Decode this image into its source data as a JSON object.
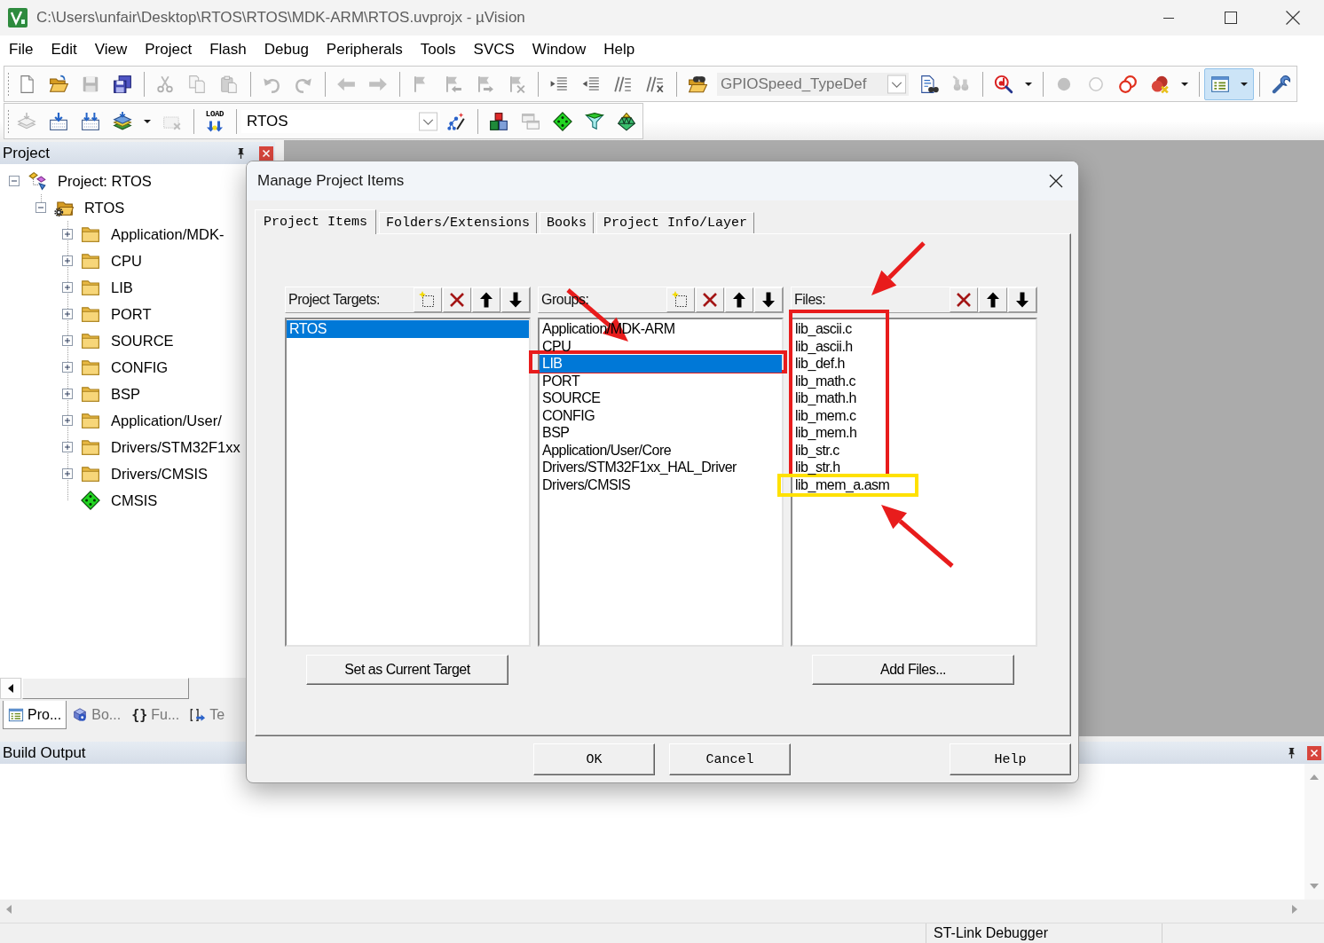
{
  "window": {
    "title": "C:\\Users\\unfair\\Desktop\\RTOS\\RTOS\\MDK-ARM\\RTOS.uvprojx - µVision"
  },
  "menu": [
    "File",
    "Edit",
    "View",
    "Project",
    "Flash",
    "Debug",
    "Peripherals",
    "Tools",
    "SVCS",
    "Window",
    "Help"
  ],
  "toolbar_1": [
    [
      {
        "kind": "button",
        "disabled": false,
        "pressed": false
      },
      {
        "kind": "button",
        "disabled": false,
        "pressed": false
      },
      {
        "kind": "button",
        "disabled": true,
        "pressed": false
      },
      {
        "kind": "button",
        "disabled": false,
        "pressed": false
      }
    ],
    [
      {
        "kind": "button",
        "disabled": true,
        "pressed": false
      },
      {
        "kind": "button",
        "disabled": true,
        "pressed": false
      },
      {
        "kind": "button",
        "disabled": true,
        "pressed": false
      }
    ],
    [
      {
        "kind": "button",
        "disabled": true,
        "pressed": false
      },
      {
        "kind": "button",
        "disabled": true,
        "pressed": false
      }
    ],
    [
      {
        "kind": "button",
        "disabled": true,
        "pressed": false
      },
      {
        "kind": "button",
        "disabled": true,
        "pressed": false
      }
    ],
    [
      {
        "kind": "button",
        "disabled": true,
        "pressed": false
      },
      {
        "kind": "button",
        "disabled": true,
        "pressed": false
      },
      {
        "kind": "button",
        "disabled": true,
        "pressed": false
      },
      {
        "kind": "button",
        "disabled": true,
        "pressed": false
      }
    ],
    [
      {
        "kind": "button",
        "disabled": false,
        "pressed": false
      },
      {
        "kind": "button",
        "disabled": false,
        "pressed": false
      },
      {
        "kind": "button",
        "disabled": false,
        "pressed": false
      },
      {
        "kind": "button",
        "disabled": false,
        "pressed": false
      }
    ],
    [
      {
        "kind": "button",
        "disabled": false,
        "pressed": false
      },
      {
        "kind": "combo",
        "value": "GPIOSpeed_TypeDef"
      },
      {
        "kind": "button",
        "disabled": false,
        "pressed": false
      },
      {
        "kind": "button",
        "disabled": true,
        "pressed": false
      }
    ],
    [
      {
        "kind": "split",
        "disabled": false,
        "pressed": false
      }
    ],
    [
      {
        "kind": "button",
        "disabled": true,
        "pressed": false
      },
      {
        "kind": "button",
        "disabled": true,
        "pressed": false
      },
      {
        "kind": "button",
        "disabled": false,
        "pressed": false
      },
      {
        "kind": "split",
        "disabled": false,
        "pressed": false
      }
    ],
    [
      {
        "kind": "split",
        "disabled": false,
        "pressed": true
      }
    ],
    [
      {
        "kind": "button",
        "disabled": false,
        "pressed": false
      }
    ]
  ],
  "toolbar_2": [
    [
      {
        "kind": "button",
        "disabled": true,
        "pressed": false
      },
      {
        "kind": "button",
        "disabled": false,
        "pressed": false
      },
      {
        "kind": "button",
        "disabled": false,
        "pressed": false
      },
      {
        "kind": "split",
        "disabled": false,
        "pressed": false
      },
      {
        "kind": "button",
        "disabled": true,
        "pressed": false
      }
    ],
    [
      {
        "kind": "button",
        "label": "LOAD",
        "disabled": false,
        "pressed": false
      }
    ],
    [
      {
        "kind": "combo",
        "value": "RTOS"
      },
      {
        "kind": "button",
        "disabled": false,
        "pressed": false
      }
    ],
    [
      {
        "kind": "button",
        "disabled": false,
        "pressed": false
      },
      {
        "kind": "button",
        "disabled": true,
        "pressed": false
      },
      {
        "kind": "button",
        "disabled": false,
        "pressed": false
      },
      {
        "kind": "button",
        "disabled": false,
        "pressed": false
      },
      {
        "kind": "button",
        "disabled": false,
        "pressed": false
      }
    ]
  ],
  "project_panel": {
    "title": "Project",
    "tree": [
      {
        "label": "Project: RTOS",
        "kind": "project",
        "expanded": true,
        "children": [
          {
            "label": "RTOS",
            "kind": "target",
            "expanded": true,
            "children": [
              {
                "label": "Application/MDK-",
                "kind": "group",
                "expanded": false
              },
              {
                "label": "CPU",
                "kind": "group",
                "expanded": false
              },
              {
                "label": "LIB",
                "kind": "group",
                "expanded": false
              },
              {
                "label": "PORT",
                "kind": "group",
                "expanded": false
              },
              {
                "label": "SOURCE",
                "kind": "group",
                "expanded": false
              },
              {
                "label": "CONFIG",
                "kind": "group",
                "expanded": false
              },
              {
                "label": "BSP",
                "kind": "group",
                "expanded": false
              },
              {
                "label": "Application/User/",
                "kind": "group",
                "expanded": false
              },
              {
                "label": "Drivers/STM32F1xx",
                "kind": "group",
                "expanded": false
              },
              {
                "label": "Drivers/CMSIS",
                "kind": "group",
                "expanded": false
              },
              {
                "label": "CMSIS",
                "kind": "component"
              }
            ]
          }
        ]
      }
    ],
    "tabs": [
      {
        "label": "Pro...",
        "selected": true
      },
      {
        "label": "Bo...",
        "selected": false
      },
      {
        "glyph": "{}",
        "label": "Fu...",
        "selected": false
      },
      {
        "label": "Te",
        "selected": false
      }
    ]
  },
  "build_output": {
    "title": "Build Output"
  },
  "status_bar": {
    "text": "ST-Link Debugger"
  },
  "dialog": {
    "title": "Manage Project Items",
    "tabs": [
      {
        "label": "Project Items",
        "selected": true
      },
      {
        "label": "Folders/Extensions",
        "selected": false
      },
      {
        "label": "Books",
        "selected": false
      },
      {
        "label": "Project Info/Layer",
        "selected": false
      }
    ],
    "panels": [
      {
        "kind": "targets",
        "label": "Project Targets:",
        "items": [
          {
            "label": "RTOS",
            "selected": true
          }
        ],
        "button": "Set as Current Target"
      },
      {
        "kind": "groups",
        "label": "Groups:",
        "items": [
          {
            "label": "Application/MDK-ARM",
            "selected": false
          },
          {
            "label": "CPU",
            "selected": false
          },
          {
            "label": "LIB",
            "selected": true
          },
          {
            "label": "PORT",
            "selected": false
          },
          {
            "label": "SOURCE",
            "selected": false
          },
          {
            "label": "CONFIG",
            "selected": false
          },
          {
            "label": "BSP",
            "selected": false
          },
          {
            "label": "Application/User/Core",
            "selected": false
          },
          {
            "label": "Drivers/STM32F1xx_HAL_Driver",
            "selected": false
          },
          {
            "label": "Drivers/CMSIS",
            "selected": false
          }
        ]
      },
      {
        "kind": "files",
        "label": "Files:",
        "items": [
          {
            "label": "lib_ascii.c",
            "selected": false
          },
          {
            "label": "lib_ascii.h",
            "selected": false
          },
          {
            "label": "lib_def.h",
            "selected": false
          },
          {
            "label": "lib_math.c",
            "selected": false
          },
          {
            "label": "lib_math.h",
            "selected": false
          },
          {
            "label": "lib_mem.c",
            "selected": false
          },
          {
            "label": "lib_mem.h",
            "selected": false
          },
          {
            "label": "lib_str.c",
            "selected": false
          },
          {
            "label": "lib_str.h",
            "selected": false
          },
          {
            "label": "lib_mem_a.asm",
            "selected": false
          }
        ],
        "button": "Add Files..."
      }
    ],
    "buttons": [
      "OK",
      "Cancel",
      "Help"
    ]
  },
  "annotations": [
    {
      "kind": "frame",
      "color": "#e81c1c"
    },
    {
      "kind": "frame",
      "color": "#e81c1c"
    },
    {
      "kind": "frame",
      "color": "#ffe100"
    },
    {
      "kind": "arrow",
      "color": "#e81c1c"
    },
    {
      "kind": "arrow",
      "color": "#e81c1c"
    },
    {
      "kind": "arrow",
      "color": "#e81c1c"
    }
  ]
}
